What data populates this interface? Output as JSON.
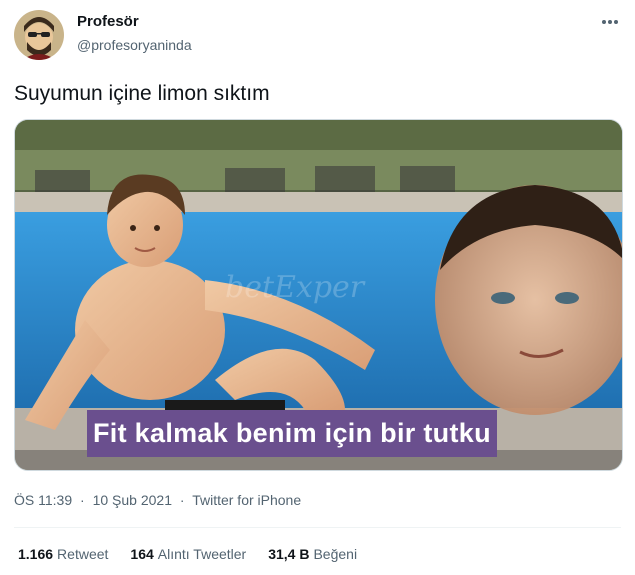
{
  "author": {
    "display_name": "Profesör",
    "handle": "@profesoryaninda"
  },
  "tweet": {
    "text": "Suyumun içine limon sıktım",
    "media": {
      "caption": "Fit kalmak benim için bir tutku",
      "watermark": "betExper"
    },
    "time": "ÖS 11:39",
    "date": "10 Şub 2021",
    "separator": "·",
    "source": "Twitter for iPhone"
  },
  "stats": {
    "retweets": {
      "count": "1.166",
      "label": "Retweet"
    },
    "quotes": {
      "count": "164",
      "label": "Alıntı Tweetler"
    },
    "likes": {
      "count": "31,4 B",
      "label": "Beğeni"
    }
  },
  "icons": {
    "more": "more-horizontal-icon",
    "avatar": "profile-avatar"
  },
  "colors": {
    "text": "#0f1419",
    "secondary": "#536471",
    "caption_bg": "#6a4f8e",
    "pool": "#2d8fd0"
  }
}
